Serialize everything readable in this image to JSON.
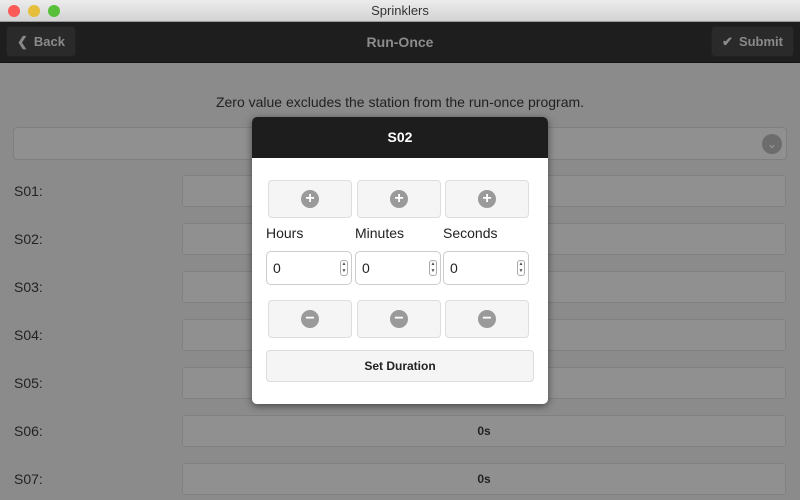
{
  "window": {
    "title": "Sprinklers"
  },
  "header": {
    "back_label": "Back",
    "title": "Run-Once",
    "submit_label": "Submit"
  },
  "info_text": "Zero value excludes the station from the run-once program.",
  "stations": [
    {
      "label": "S01:",
      "value": ""
    },
    {
      "label": "S02:",
      "value": ""
    },
    {
      "label": "S03:",
      "value": ""
    },
    {
      "label": "S04:",
      "value": ""
    },
    {
      "label": "S05:",
      "value": ""
    },
    {
      "label": "S06:",
      "value": "0s"
    },
    {
      "label": "S07:",
      "value": "0s"
    }
  ],
  "dialog": {
    "title": "S02",
    "fields": [
      {
        "label": "Hours",
        "value": "0"
      },
      {
        "label": "Minutes",
        "value": "0"
      },
      {
        "label": "Seconds",
        "value": "0"
      }
    ],
    "set_label": "Set Duration"
  },
  "colors": {
    "header": "#1e1e1e",
    "overlay_bg": "#8b8b8b",
    "close": "#fc5b57",
    "minimize": "#e5bf3c",
    "zoom": "#57c038"
  }
}
